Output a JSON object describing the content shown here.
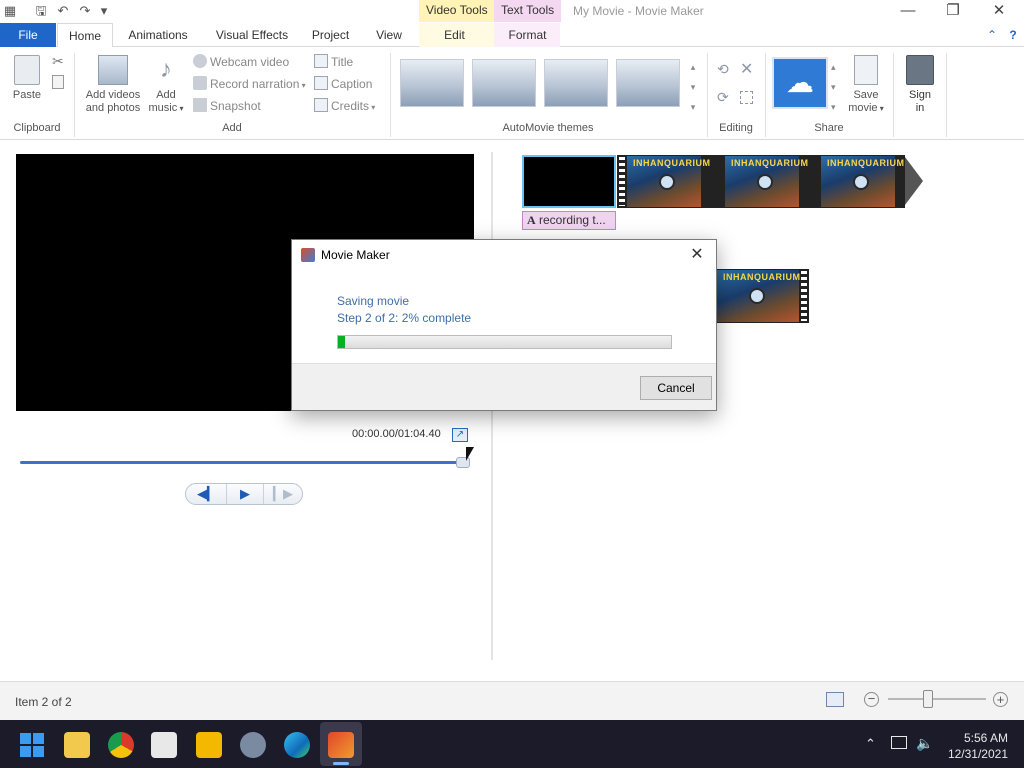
{
  "titlebar": {
    "title": "My Movie - Movie Maker",
    "context_tabs": {
      "video_tools": "Video Tools",
      "text_tools": "Text Tools"
    },
    "context_colors": {
      "video_tools": "#fff3b5",
      "text_tools": "#f4d7f0"
    },
    "window_buttons": {
      "minimize": "—",
      "maximize": "❐",
      "close": "✕"
    }
  },
  "tabs": {
    "file": "File",
    "home": "Home",
    "animations": "Animations",
    "visual_effects": "Visual Effects",
    "project": "Project",
    "view": "View",
    "edit": "Edit",
    "format": "Format",
    "help": "?"
  },
  "ribbon": {
    "clipboard": {
      "label": "Clipboard",
      "paste": "Paste"
    },
    "add": {
      "label": "Add",
      "add_videos_line1": "Add videos",
      "add_videos_line2": "and photos",
      "add_music_line1": "Add",
      "add_music_line2": "music",
      "webcam": "Webcam video",
      "narration": "Record narration",
      "snapshot": "Snapshot",
      "title": "Title",
      "caption": "Caption",
      "credits": "Credits"
    },
    "themes": {
      "label": "AutoMovie themes"
    },
    "editing": {
      "label": "Editing"
    },
    "share": {
      "label": "Share",
      "save_movie_line1": "Save",
      "save_movie_line2": "movie"
    },
    "signin": {
      "line1": "Sign",
      "line2": "in"
    }
  },
  "preview": {
    "timecode": "00:00.00/01:04.40",
    "seek_position": 1.0
  },
  "storyboard": {
    "caption_label": "recording t...",
    "thumb_text": "INHANQUARIUM"
  },
  "status": {
    "item_text": "Item 2 of 2"
  },
  "dialog": {
    "title": "Movie Maker",
    "line1": "Saving movie",
    "line2": "Step 2 of 2: 2% complete",
    "progress": 0.02,
    "cancel": "Cancel"
  },
  "taskbar": {
    "time": "5:56 AM",
    "date": "12/31/2021"
  }
}
